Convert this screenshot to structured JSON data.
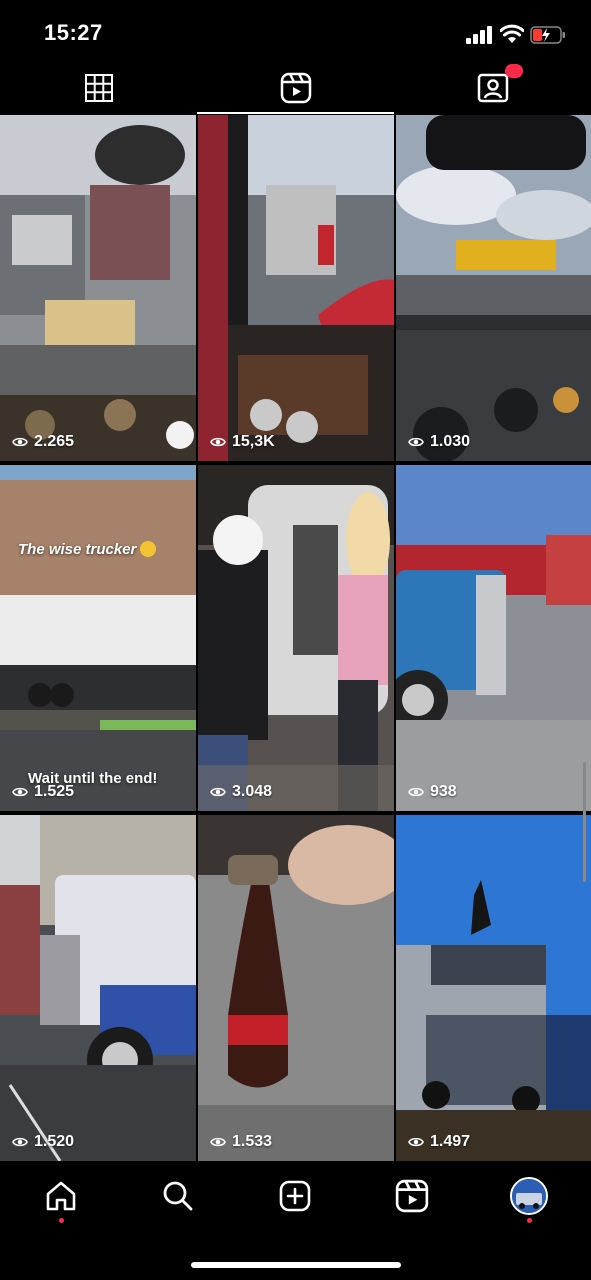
{
  "status_bar": {
    "time": "15:27"
  },
  "tabs": [
    {
      "icon": "grid-icon",
      "active": false
    },
    {
      "icon": "reels-icon",
      "active": true
    },
    {
      "icon": "tagged-icon",
      "active": false
    }
  ],
  "tiles": [
    {
      "views": "2.265"
    },
    {
      "views": "15,3K"
    },
    {
      "views": "1.030"
    },
    {
      "views": "1.525",
      "overlay_top": "The wise trucker",
      "overlay_bottom": "Wait until the end!"
    },
    {
      "views": "3.048"
    },
    {
      "views": "938"
    },
    {
      "views": "1.520"
    },
    {
      "views": "1.533"
    },
    {
      "views": "1.497"
    }
  ],
  "nav": [
    {
      "icon": "home-icon"
    },
    {
      "icon": "search-icon"
    },
    {
      "icon": "create-icon"
    },
    {
      "icon": "reels-icon"
    },
    {
      "icon": "profile-avatar"
    }
  ],
  "colors": {
    "accent": "#ff2a4b",
    "background": "#000000"
  }
}
